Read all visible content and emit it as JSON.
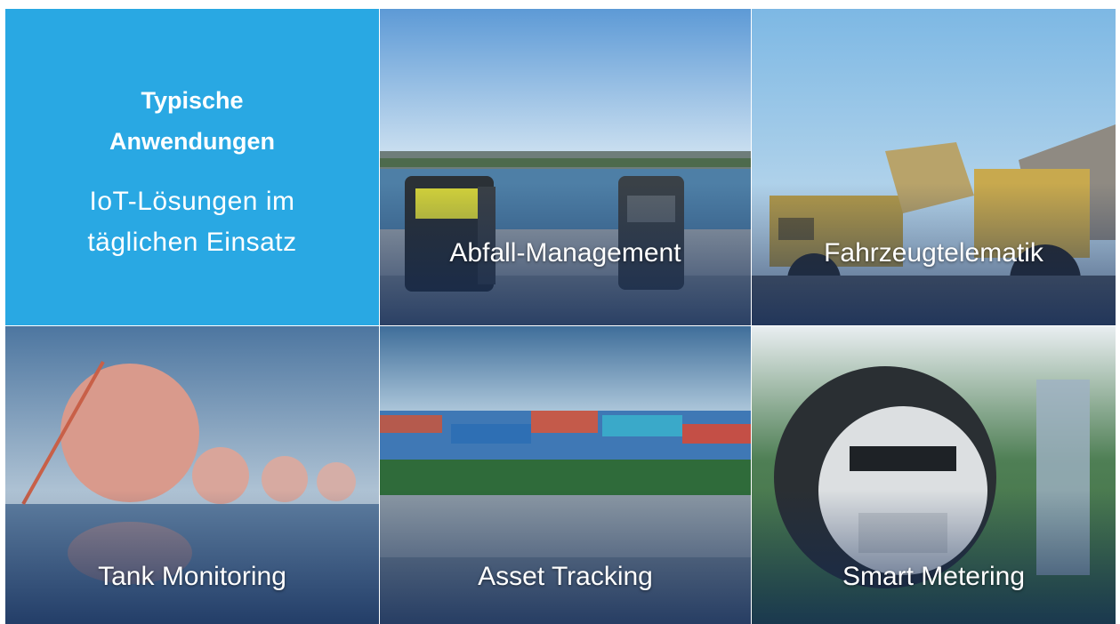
{
  "intro": {
    "heading_line1": "Typische",
    "heading_line2": "Anwendungen",
    "subheading_line1": "IoT-Lösungen im",
    "subheading_line2": "täglichen Einsatz",
    "background": "#29a8e3"
  },
  "tiles": [
    {
      "label": "Abfall-Management"
    },
    {
      "label": "Fahrzeugtelematik"
    },
    {
      "label": "Tank Monitoring"
    },
    {
      "label": "Asset Tracking"
    },
    {
      "label": "Smart Metering"
    }
  ]
}
